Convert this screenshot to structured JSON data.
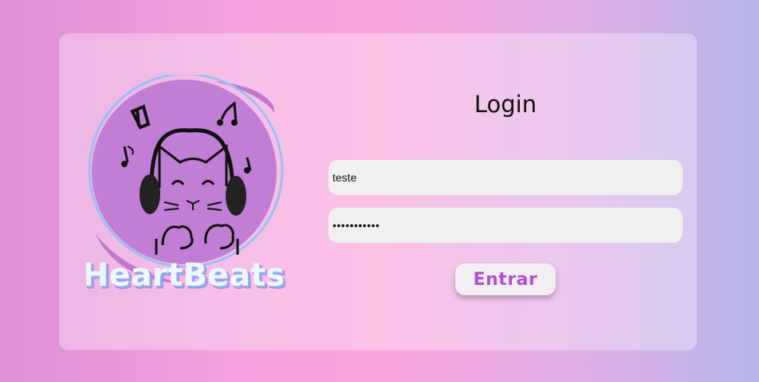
{
  "logo": {
    "brand_text": "HeartBeats",
    "accent_color": "#c080d4"
  },
  "login": {
    "title": "Login",
    "username_value": "teste",
    "password_value": "12345678901",
    "submit_label": "Entrar"
  },
  "colors": {
    "button_text": "#b050d0",
    "field_bg": "#f1f0f1"
  }
}
